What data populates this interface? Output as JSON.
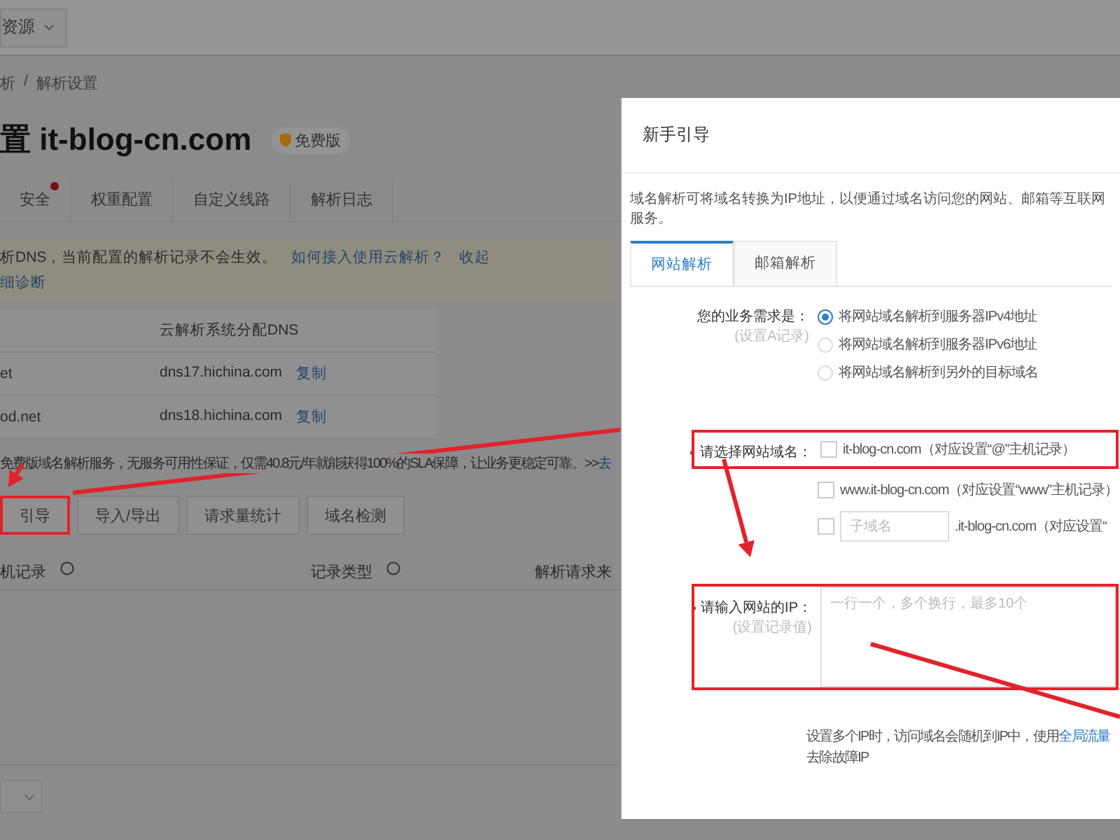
{
  "top_bar": {
    "resource_select": "资源"
  },
  "breadcrumb": {
    "items": [
      "析",
      "解析设置"
    ],
    "separator": "/"
  },
  "page_title": {
    "text": "置 it-blog-cn.com",
    "badge": "免费版"
  },
  "tabs": [
    {
      "label": "安全",
      "alert": true
    },
    {
      "label": "权重配置",
      "alert": false
    },
    {
      "label": "自定义线路",
      "alert": false
    },
    {
      "label": "解析日志",
      "alert": false
    }
  ],
  "notice": {
    "text": "析DNS，当前配置的解析记录不会生效。",
    "links": [
      "如何接入使用云解析？",
      "收起"
    ],
    "second_line_link": "细诊断"
  },
  "dns_table": {
    "header": "云解析系统分配DNS",
    "rows": [
      {
        "current": "et",
        "assigned": "dns17.hichina.com",
        "action": "复制"
      },
      {
        "current": "od.net",
        "assigned": "dns18.hichina.com",
        "action": "复制"
      }
    ]
  },
  "promo": {
    "text": "免费版域名解析服务，无服务可用性保证，仅需40.8元/年就能获得100%的SLA保障，让业务更稳定可靠。>>",
    "link": "去"
  },
  "actions": [
    {
      "label": "引导",
      "highlighted": true
    },
    {
      "label": "导入/导出",
      "highlighted": false
    },
    {
      "label": "请求量统计",
      "highlighted": false
    },
    {
      "label": "域名检测",
      "highlighted": false
    }
  ],
  "records_table": {
    "columns": [
      "机记录",
      "记录类型",
      "解析请求来"
    ]
  },
  "modal": {
    "title": "新手引导",
    "description": "域名解析可将域名转换为IP地址，以便通过域名访问您的网站、邮箱等互联网服务。",
    "tabs": [
      {
        "label": "网站解析",
        "selected": true
      },
      {
        "label": "邮箱解析",
        "selected": false
      }
    ],
    "business": {
      "label": "您的业务需求是：",
      "sublabel": "(设置A记录)",
      "options": [
        {
          "label": "将网站域名解析到服务器IPv4地址",
          "selected": true
        },
        {
          "label": "将网站域名解析到服务器IPv6地址",
          "selected": false
        },
        {
          "label": "将网站域名解析到另外的目标域名",
          "selected": false
        }
      ]
    },
    "domain": {
      "label": "请选择网站域名：",
      "required": true,
      "highlighted": true,
      "options": [
        {
          "kind": "plain",
          "label": "it-blog-cn.com（对应设置“@”主机记录）",
          "checked": false
        },
        {
          "kind": "plain",
          "label": "www.it-blog-cn.com（对应设置“www”主机记录）",
          "checked": false
        },
        {
          "kind": "subdomain",
          "placeholder": "子域名",
          "suffix": ".it-blog-cn.com（对应设置“",
          "checked": false
        }
      ]
    },
    "ip": {
      "label": "请输入网站的IP：",
      "sublabel": "(设置记录值)",
      "placeholder": "一行一个，多个换行，最多10个",
      "required": true,
      "highlighted": true
    },
    "hint": {
      "text": "设置多个IP时，访问域名会随机到IP中，使用",
      "link": "全局流量",
      "second_line": "去除故障IP"
    }
  }
}
